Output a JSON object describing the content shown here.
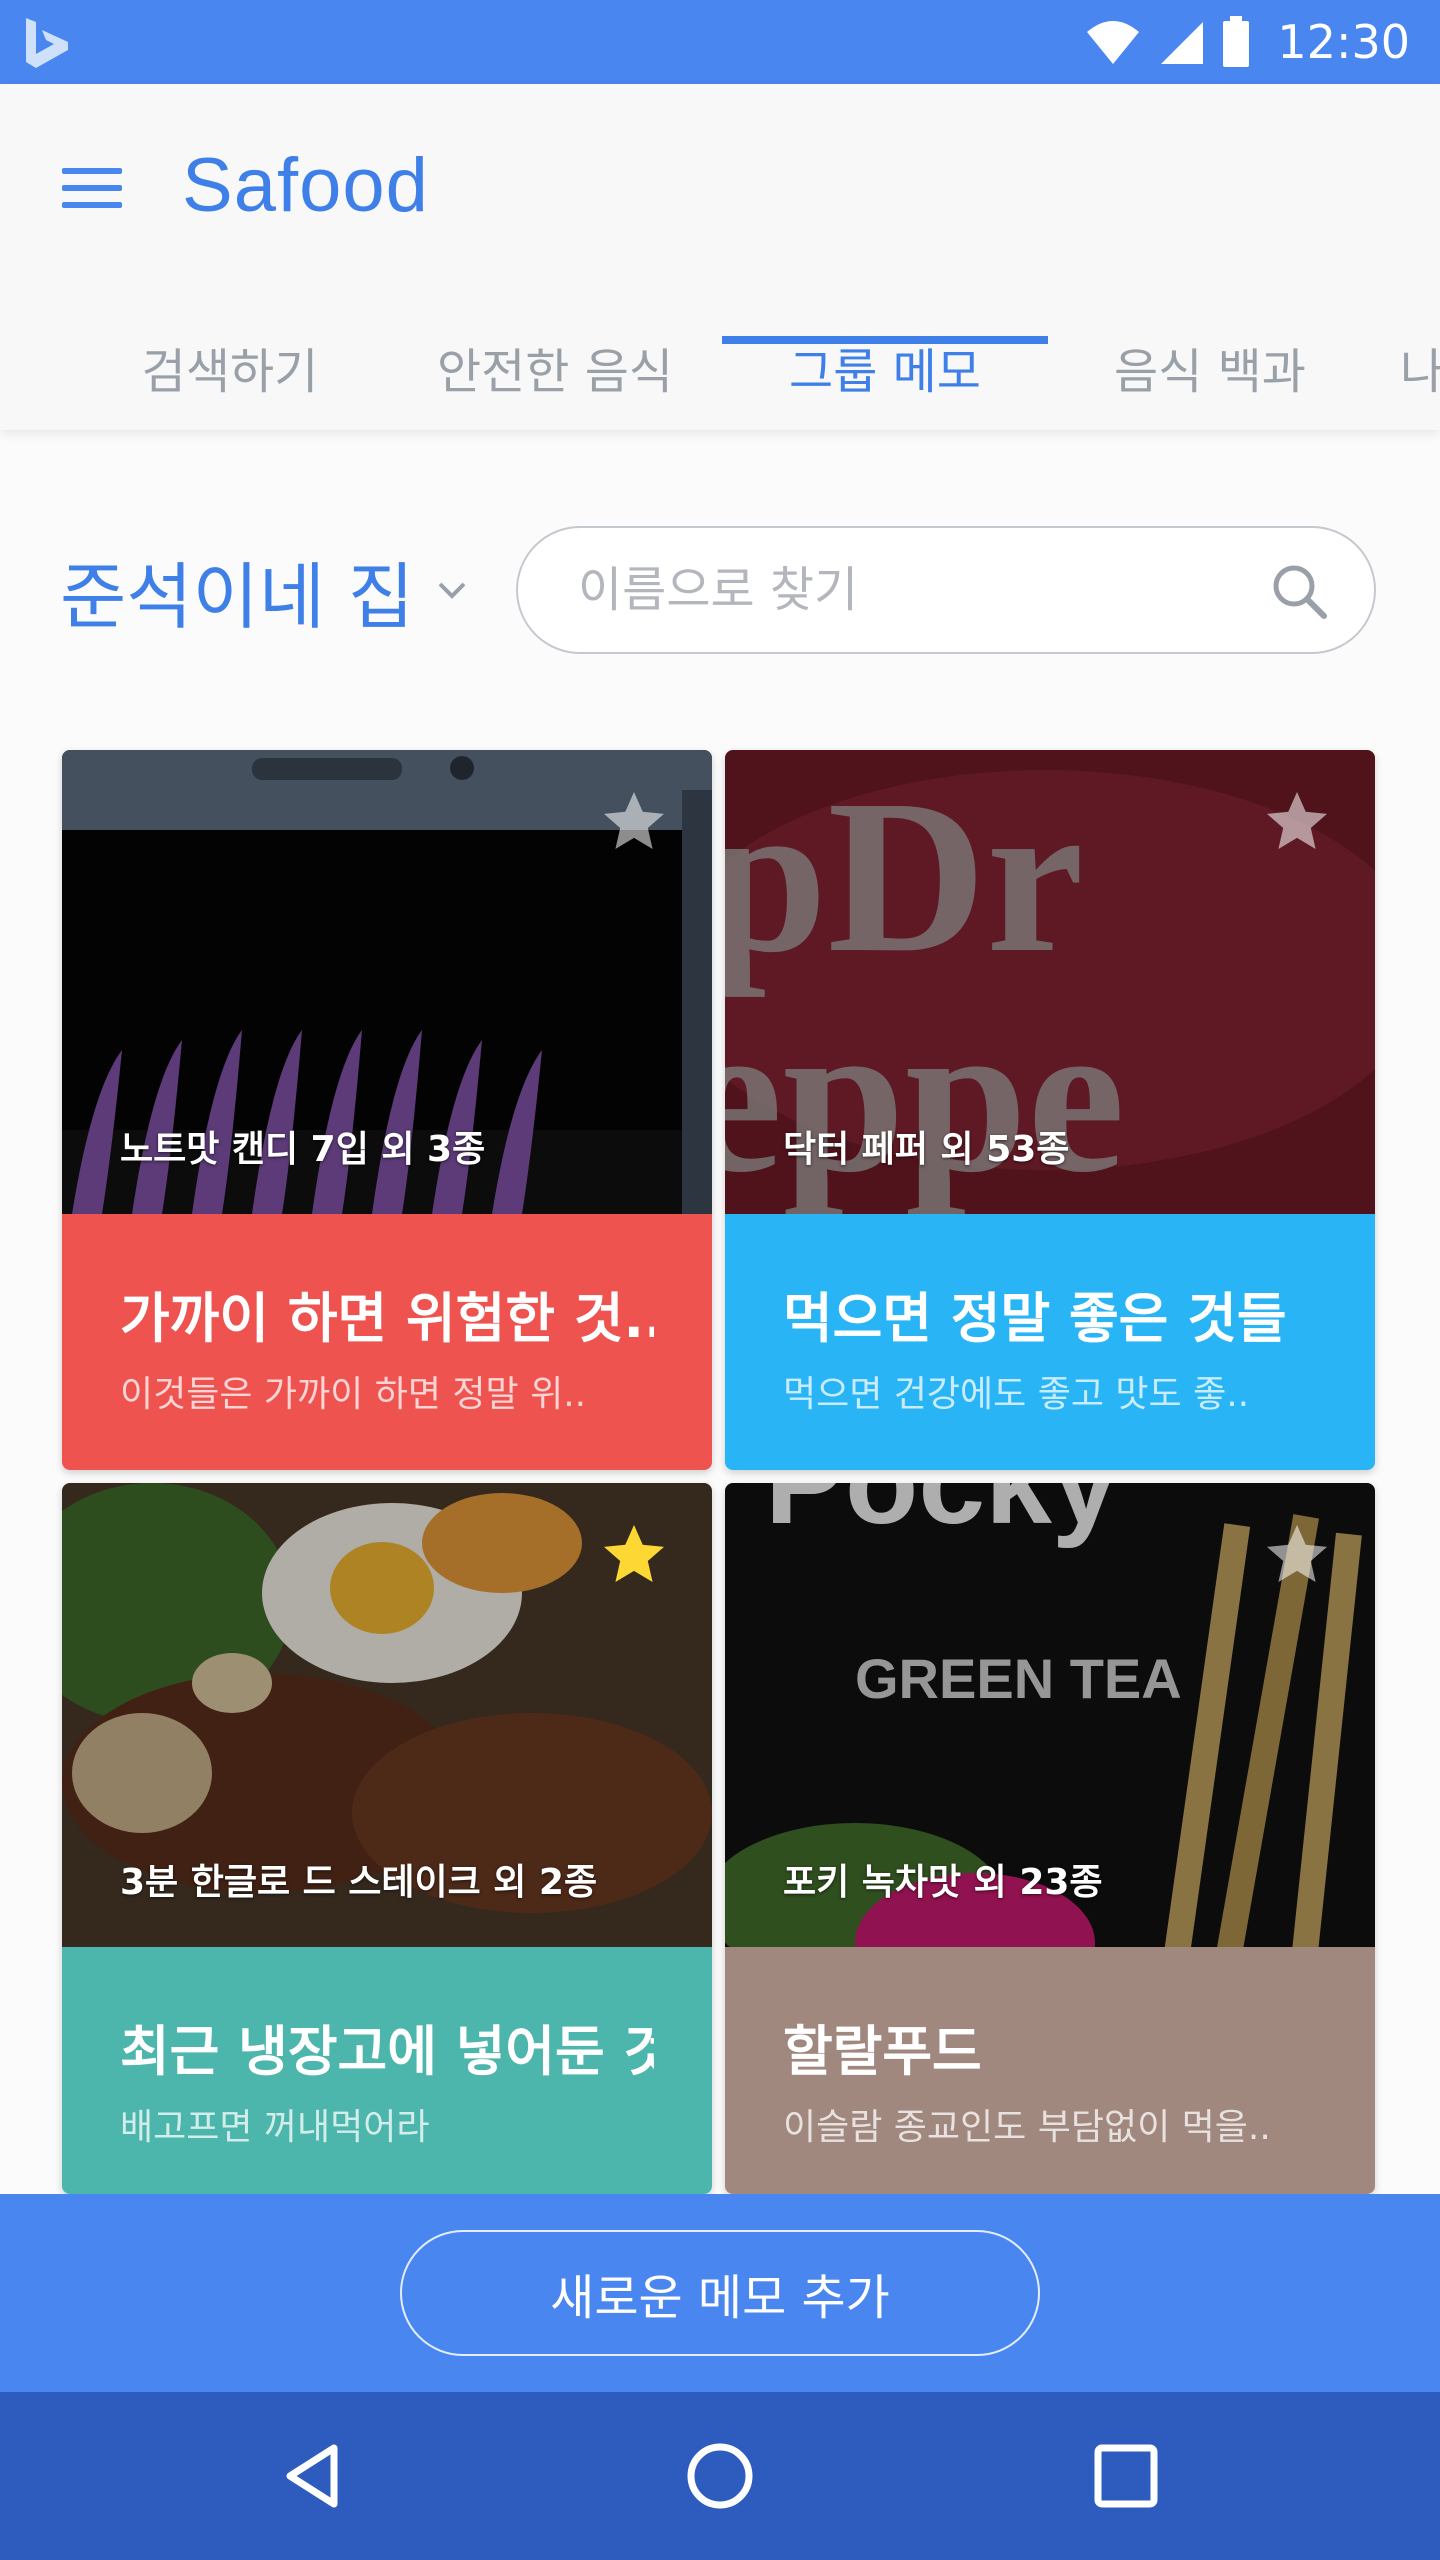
{
  "status": {
    "time": "12:30"
  },
  "app": {
    "title": "Safood"
  },
  "tabs": [
    {
      "label": "검색하기"
    },
    {
      "label": "안전한 음식"
    },
    {
      "label": "그룹 메모"
    },
    {
      "label": "음식 백과"
    },
    {
      "label": "나"
    }
  ],
  "active_tab": "그룹 메모",
  "group": {
    "name": "준석이네 집"
  },
  "search": {
    "placeholder": "이름으로 찾기",
    "value": ""
  },
  "cards": [
    {
      "caption": "노트맛 캔디 7입 외 3종",
      "title": "가까이 하면 위험한 것..",
      "desc": "이것들은 가까이 하면 정말  위..",
      "color": "#ee5350",
      "starred": false
    },
    {
      "caption": "닥터 페퍼 외 53종",
      "title": "먹으면 정말 좋은 것들",
      "desc": "먹으면 건강에도 좋고 맛도 좋..",
      "color": "#29b5f5",
      "starred": false
    },
    {
      "caption": "3분 한글로 드 스테이크 외 2종",
      "title": "최근 냉장고에 넣어둔 것",
      "desc": "배고프면 꺼내먹어라",
      "color": "#4db6ac",
      "starred": true
    },
    {
      "caption": "포키 녹차맛 외 23종",
      "title": "할랄푸드",
      "desc": "이슬람 종교인도 부담없이 먹을..",
      "color": "#a1887f",
      "starred": false
    }
  ],
  "actions": {
    "add_memo": "새로운 메모 추가"
  },
  "colors": {
    "primary": "#4a86f0",
    "nav": "#2e5cbe",
    "star_active": "#fdd835"
  }
}
